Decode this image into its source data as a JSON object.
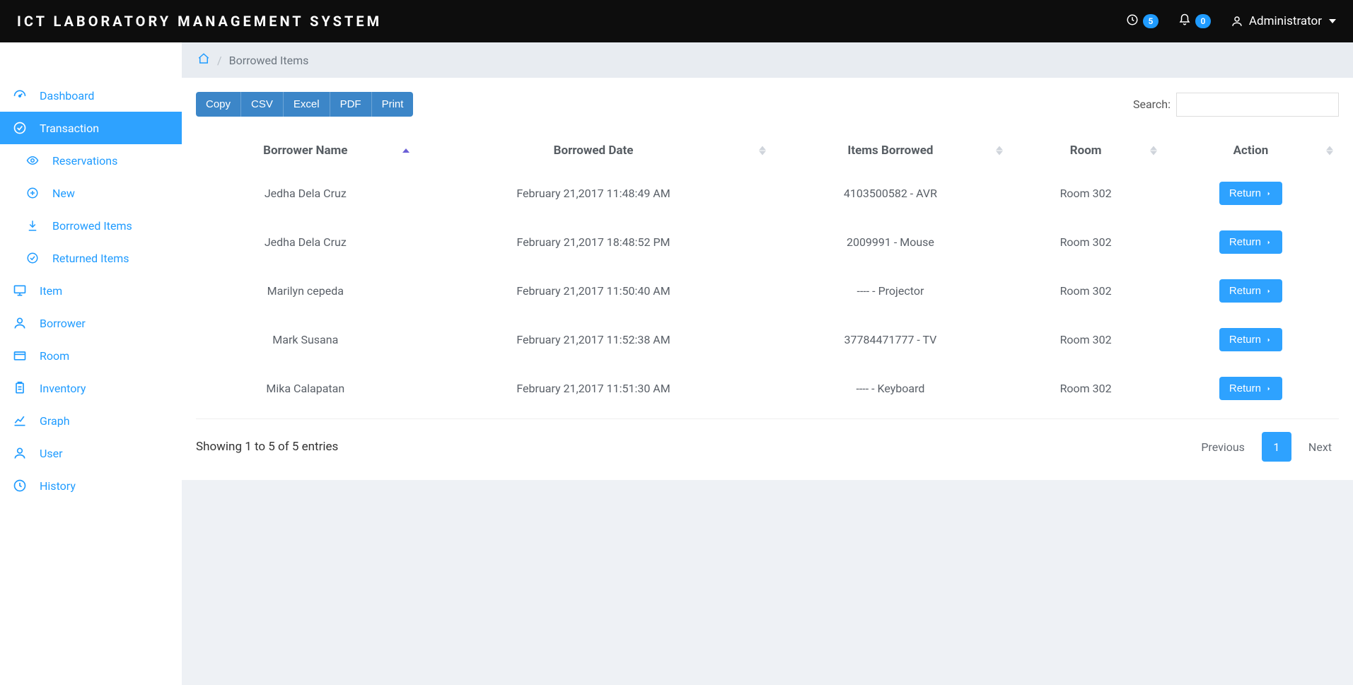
{
  "header": {
    "brand": "ICT LABORATORY MANAGEMENT SYSTEM",
    "clock_badge": "5",
    "notif_badge": "0",
    "user_label": "Administrator"
  },
  "sidebar": {
    "items": [
      {
        "icon": "gauge",
        "label": "Dashboard"
      },
      {
        "icon": "check-circle",
        "label": "Transaction",
        "active": true
      },
      {
        "icon": "monitor",
        "label": "Item"
      },
      {
        "icon": "person",
        "label": "Borrower"
      },
      {
        "icon": "folder",
        "label": "Room"
      },
      {
        "icon": "clipboard",
        "label": "Inventory"
      },
      {
        "icon": "chart",
        "label": "Graph"
      },
      {
        "icon": "person",
        "label": "User"
      },
      {
        "icon": "clock",
        "label": "History"
      }
    ],
    "subitems": [
      {
        "icon": "eye",
        "label": "Reservations"
      },
      {
        "icon": "plus-circle",
        "label": "New"
      },
      {
        "icon": "download",
        "label": "Borrowed Items"
      },
      {
        "icon": "check-circle",
        "label": "Returned Items"
      }
    ]
  },
  "breadcrumb": {
    "home_icon": "home",
    "current": "Borrowed Items"
  },
  "toolbar": {
    "buttons": [
      "Copy",
      "CSV",
      "Excel",
      "PDF",
      "Print"
    ],
    "search_label": "Search:",
    "search_value": ""
  },
  "table": {
    "columns": [
      "Borrower Name",
      "Borrowed Date",
      "Items Borrowed",
      "Room",
      "Action"
    ],
    "sort_col": 0,
    "sort_dir": "asc",
    "action_label": "Return",
    "rows": [
      {
        "name": "Jedha Dela Cruz",
        "date": "February 21,2017 11:48:49 AM",
        "item": "4103500582 - AVR",
        "room": "Room 302"
      },
      {
        "name": "Jedha Dela Cruz",
        "date": "February 21,2017 18:48:52 PM",
        "item": "2009991 - Mouse",
        "room": "Room 302"
      },
      {
        "name": "Marilyn cepeda",
        "date": "February 21,2017 11:50:40 AM",
        "item": "---- - Projector",
        "room": "Room 302"
      },
      {
        "name": "Mark Susana",
        "date": "February 21,2017 11:52:38 AM",
        "item": "37784471777 - TV",
        "room": "Room 302"
      },
      {
        "name": "Mika Calapatan",
        "date": "February 21,2017 11:51:30 AM",
        "item": "---- - Keyboard",
        "room": "Room 302"
      }
    ]
  },
  "footer": {
    "info": "Showing 1 to 5 of 5 entries",
    "prev": "Previous",
    "next": "Next",
    "pages": [
      "1"
    ],
    "active_page": "1"
  }
}
